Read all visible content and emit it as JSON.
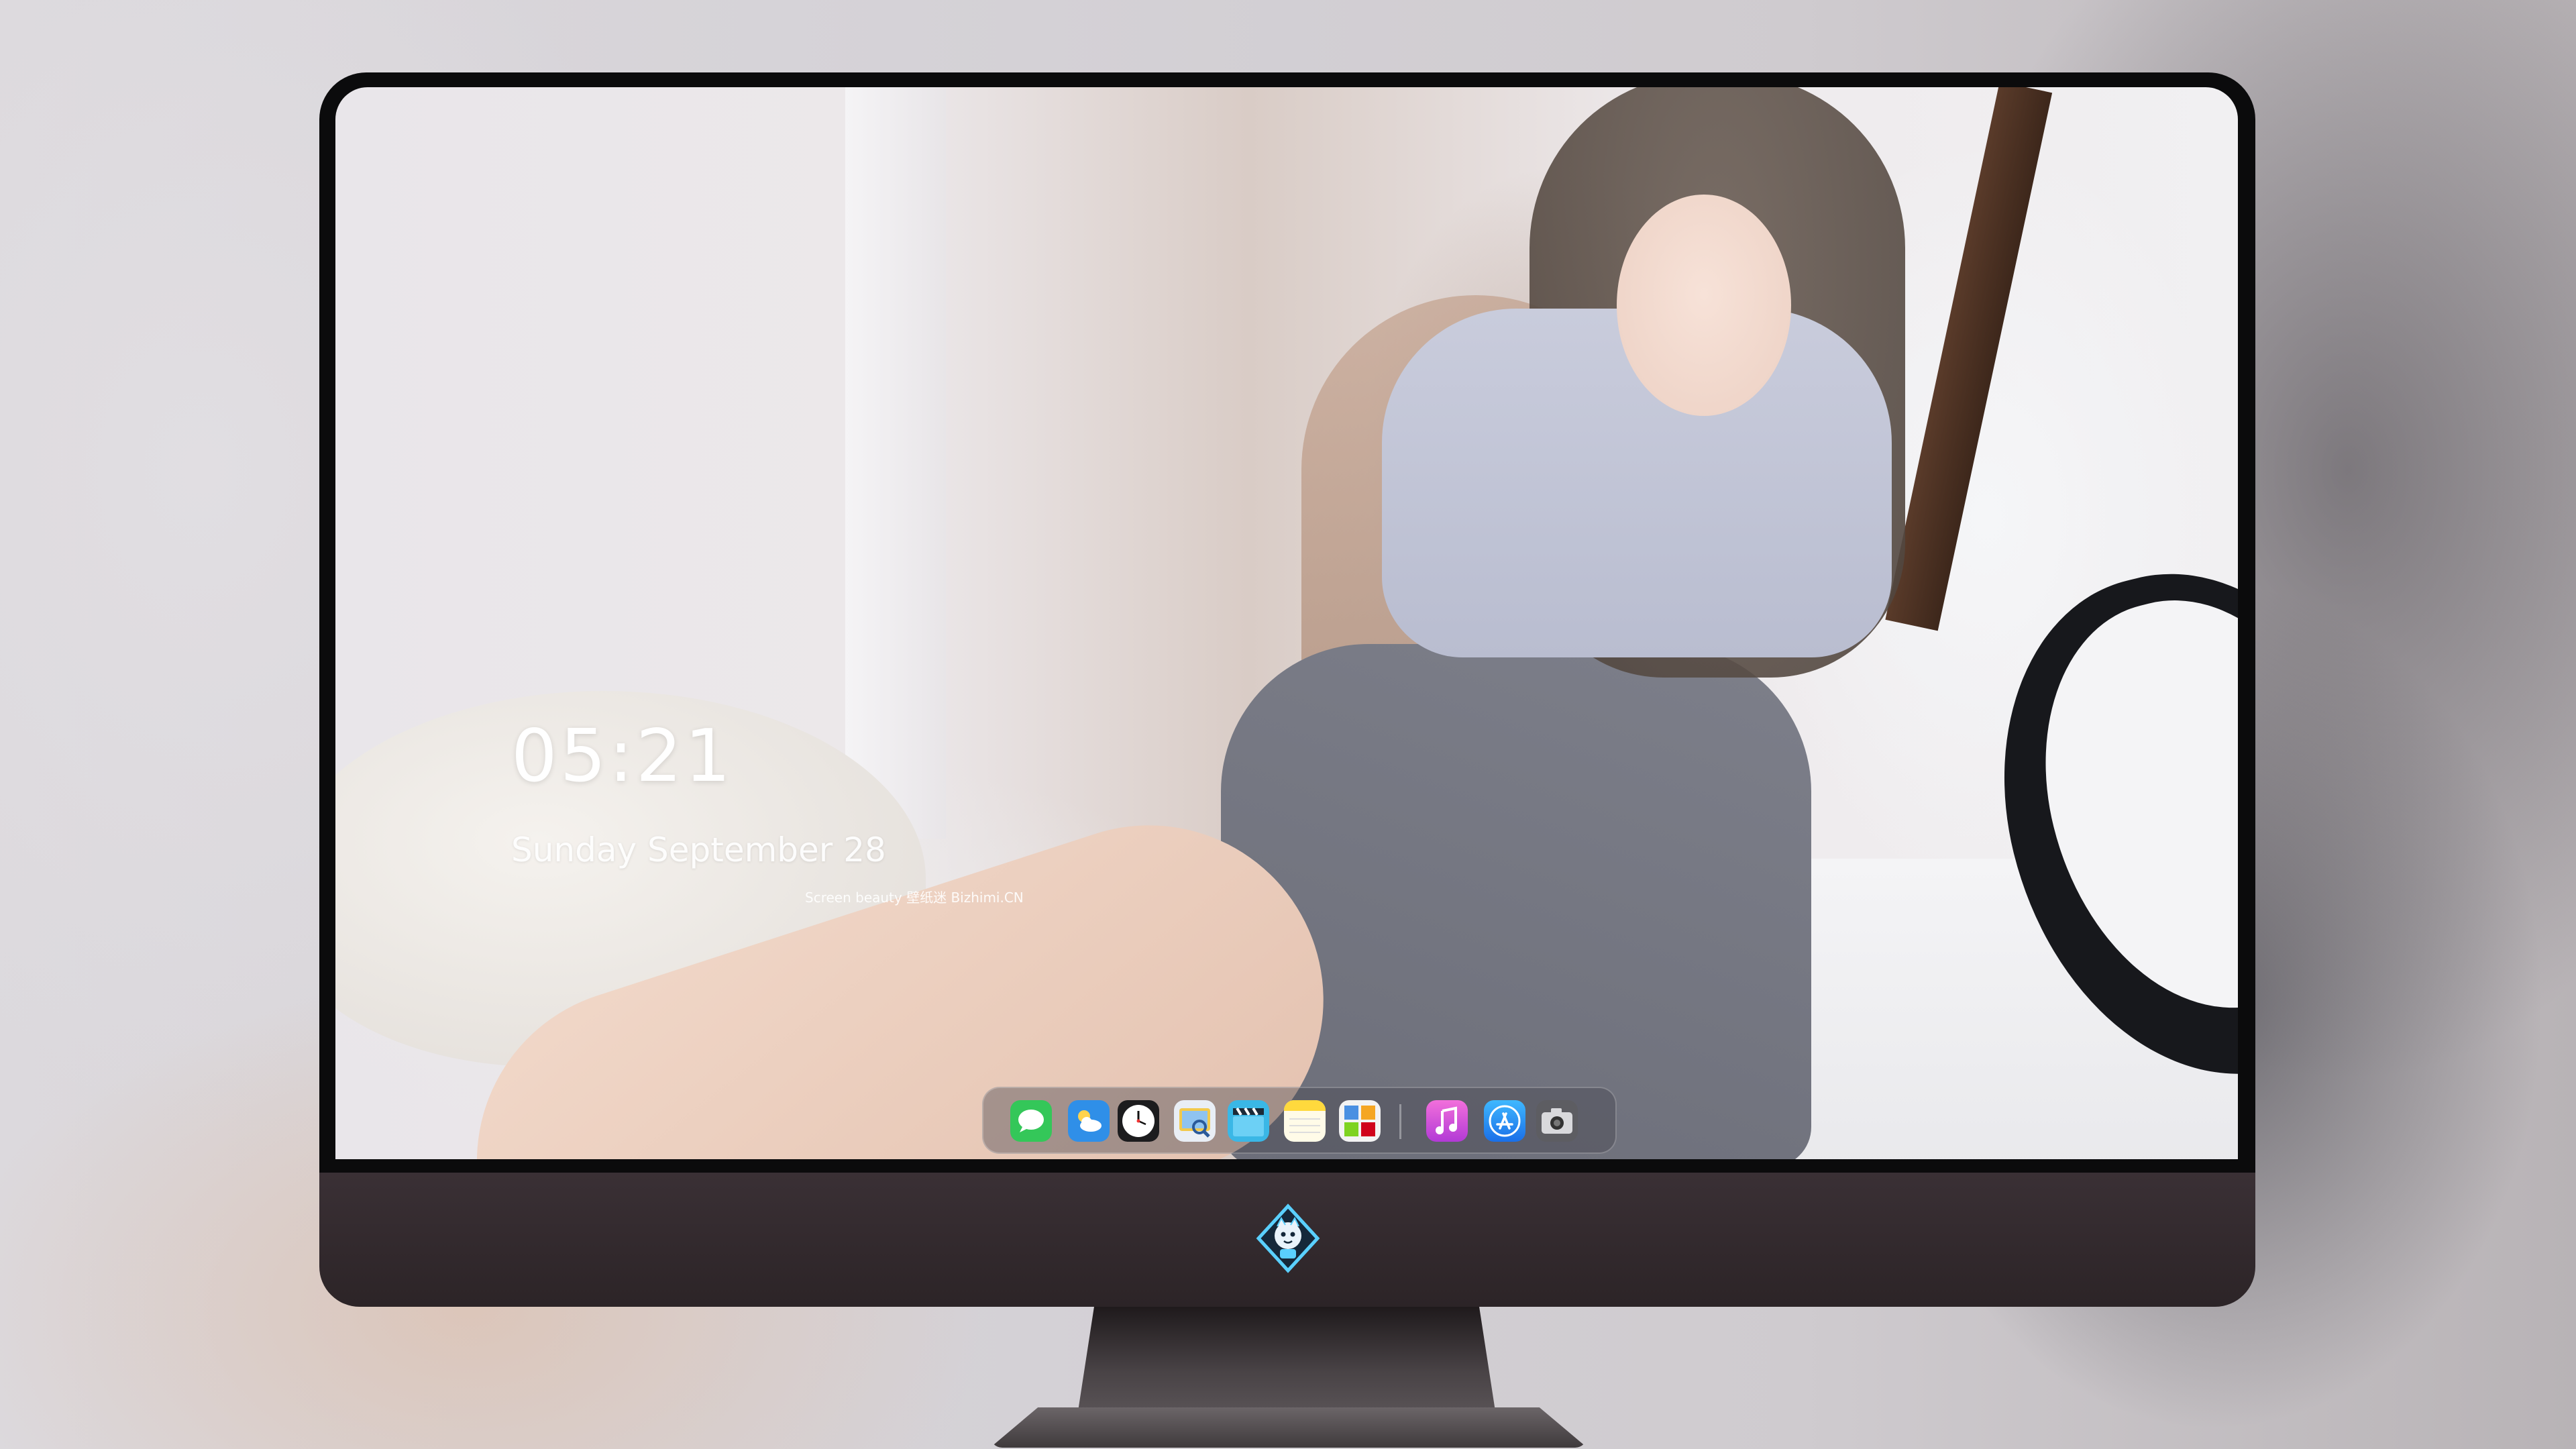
{
  "lockscreen": {
    "time": "05:21",
    "date": "Sunday September  28",
    "credit": "Screen beauty 壁纸迷 Bizhimi.CN"
  },
  "dock": {
    "apps": [
      {
        "name": "Messages",
        "icon": "messages-icon",
        "color": "#34c759"
      },
      {
        "name": "Weather",
        "icon": "weather-icon",
        "color": "#2f8fe8"
      },
      {
        "name": "Clock",
        "icon": "clock-icon",
        "color": "#ffffff"
      },
      {
        "name": "Preview",
        "icon": "preview-icon",
        "color": "#f2c94c"
      },
      {
        "name": "Final Cut",
        "icon": "clapperboard-icon",
        "color": "#3ab7e6"
      },
      {
        "name": "Notes",
        "icon": "notes-icon",
        "color": "#ffd93d"
      },
      {
        "name": "Photo Booth",
        "icon": "photos-grid-icon",
        "color": "#4a90e2"
      },
      {
        "name": "Music",
        "icon": "music-icon",
        "color": "#e14bd6"
      },
      {
        "name": "App Store",
        "icon": "app-store-icon",
        "color": "#1e90ff"
      },
      {
        "name": "Camera",
        "icon": "camera-icon",
        "color": "#6e6e6e"
      }
    ]
  },
  "monitor": {
    "chin_logo": "mascot-logo-icon"
  }
}
